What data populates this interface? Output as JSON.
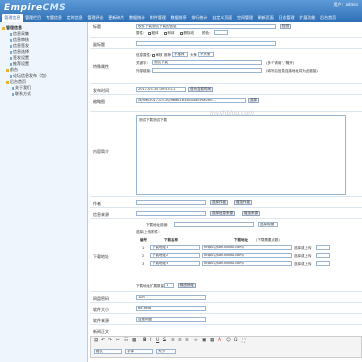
{
  "header": {
    "logo_main": "Empire",
    "logo_sub": "CMS",
    "user": "用户：admin"
  },
  "topnav": [
    "管理信息",
    "管理栏目",
    "专题信息",
    "定时信息",
    "管理评论",
    "更新碎片",
    "数据统计",
    "附件管理",
    "数据排序",
    "排行统计",
    "自定义页面",
    "空间管理",
    "刷新页面",
    "日志管理",
    "扩展功能",
    "后台首页"
  ],
  "sidebar": {
    "root": "管理信息",
    "items": [
      "信息采集",
      "信息审核",
      "信息签发",
      "信息选择",
      "签发设置",
      "推荐设置"
    ],
    "node2": "前台",
    "node2_item": "论坛信息发布（包) ",
    "node3": "后台首页",
    "node3_items": [
      "关于我们",
      "联系方式"
    ]
  },
  "form": {
    "title_label": "标题",
    "title_value": "软件下载测试下载的信息",
    "title_btn": "检测",
    "attr_label": "属性：",
    "attr_opts": [
      "粗体",
      "斜体",
      "删除线"
    ],
    "color_label": "颜色：",
    "subtitle_label": "副标题",
    "special_label": "特殊属性",
    "special_info": "信息属性：",
    "special_opts": [
      "审核",
      "推荐",
      "不推荐",
      "头条",
      "不头条"
    ],
    "keyword_label": "关键字：",
    "keyword_value": "测试下载",
    "keyword_hint": "(多个请用\",\"隔开)",
    "outlink_label": "外部链接：",
    "outlink_hint": "(填写后信息连接地址将为此链接)",
    "time_label": "发布时间",
    "time_value": "2017-03-30 09:53:11",
    "time_btn": "设为当前时间",
    "thumb_label": "缩略图",
    "thumb_value": "/d/file/2017-03-30/d6d61635b44ac56e2e0...",
    "thumb_btn": "选择",
    "intro_label": "内容简介",
    "intro_value": "测试下载测试下载",
    "watermark": "myshblog.com",
    "author_label": "作者",
    "author_btn1": "选择作者",
    "author_btn2": "增加作者",
    "source_label": "信息来源",
    "source_btn1": "选择信息来源",
    "source_btn2": "增加来源",
    "dl_label": "下载地址",
    "dl_prefix_label": "下载地址前缀：",
    "dl_prefix_btn": "选择前缀",
    "dl_select_label": "选择/上传附件：",
    "dl_headers": [
      "编号",
      "下载名称",
      "下载地址",
      "(下载需要点数)"
    ],
    "dl_rows": [
      {
        "no": "1",
        "name": "下载地址1",
        "url": "https://pan.baidu.com/",
        "op": "选择或上传"
      },
      {
        "no": "2",
        "name": "下载地址2",
        "url": "https://pan.baidu.com/",
        "op": "选择或上传"
      },
      {
        "no": "3",
        "name": "下载地址3",
        "url": "https://pan.baidu.com/",
        "op": "选择或上传"
      }
    ],
    "dl_more_label": "下载地址扩展数量：",
    "dl_more_value": "1",
    "dl_more_btn": "输出地址",
    "pwd_label": "网盘密码",
    "pwd_value": "1un",
    "size_label": "软件大小",
    "size_value": "66.6MB",
    "source2_label": "软件来源",
    "source2_value": "百度网盘",
    "body_label": "新闻正文",
    "editor_format": "格式",
    "editor_font": "字体",
    "editor_size": "大小"
  }
}
